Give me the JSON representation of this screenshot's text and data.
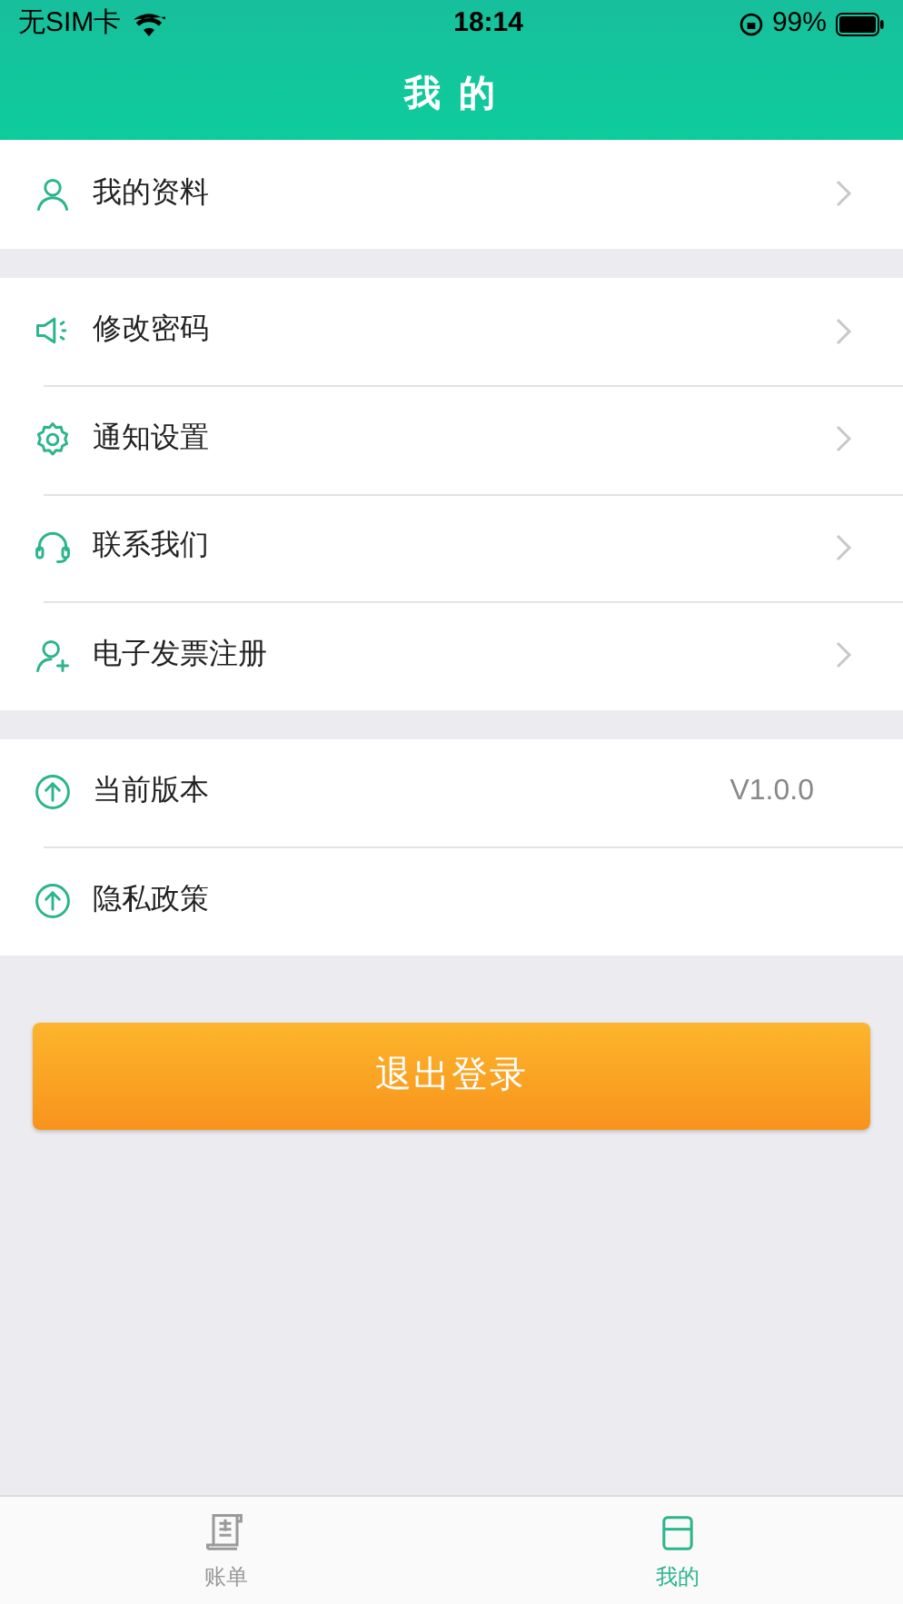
{
  "status_bar": {
    "carrier": "无SIM卡",
    "time": "18:14",
    "battery": "99%"
  },
  "header": {
    "title": "我 的"
  },
  "sections": [
    {
      "items": [
        {
          "kind": "profile",
          "label": "我的资料",
          "arrow": true
        }
      ]
    },
    {
      "items": [
        {
          "kind": "password",
          "label": "修改密码",
          "arrow": true
        },
        {
          "kind": "notification",
          "label": "通知设置",
          "arrow": true
        },
        {
          "kind": "contact",
          "label": "联系我们",
          "arrow": true
        },
        {
          "kind": "invoice",
          "label": "电子发票注册",
          "arrow": true
        }
      ]
    },
    {
      "items": [
        {
          "kind": "version",
          "label": "当前版本",
          "value": "V1.0.0",
          "arrow": false
        },
        {
          "kind": "privacy",
          "label": "隐私政策",
          "arrow": false
        }
      ]
    }
  ],
  "logout_button": "退出登录",
  "tab_bar": [
    {
      "kind": "bills",
      "label": "账单",
      "selected": false
    },
    {
      "kind": "mine",
      "label": "我的",
      "selected": true
    }
  ]
}
